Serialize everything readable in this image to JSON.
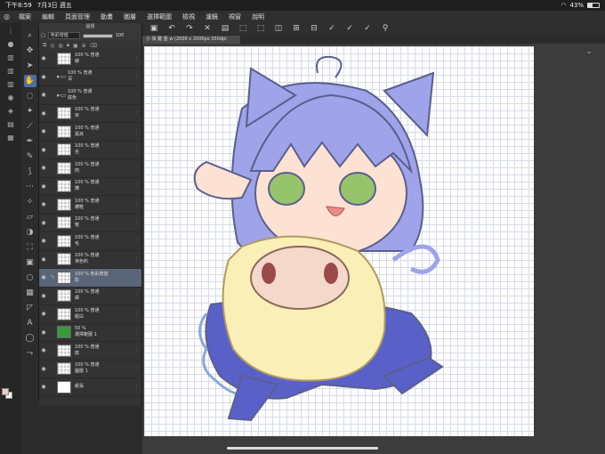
{
  "status": {
    "time": "下午8:59",
    "date": "7月3日 週五",
    "battery": "43%",
    "battery_level": 0.43
  },
  "menu": [
    "檔案",
    "編輯",
    "頁面管理",
    "動畫",
    "圖層",
    "選擇範圍",
    "檢視",
    "濾鏡",
    "視窗",
    "說明"
  ],
  "doc_tab": "小 保 鍵 盤 w (2000 x 2000px 350dpi 88.1%)",
  "layer_panel": {
    "title": "圖層",
    "blend_mode": "色彩增值",
    "opacity_value": "100",
    "opacity_level": 1.0,
    "layers": [
      {
        "pct": "100 %",
        "mode": "普通",
        "name": "線",
        "kind": "thumb"
      },
      {
        "pct": "100 %",
        "mode": "普通",
        "name": "深",
        "kind": "folder"
      },
      {
        "pct": "100 %",
        "mode": "普通",
        "name": "底色",
        "kind": "folder"
      },
      {
        "pct": "100 %",
        "mode": "普通",
        "name": "目",
        "kind": "thumb"
      },
      {
        "pct": "100 %",
        "mode": "普通",
        "name": "黑目",
        "kind": "thumb"
      },
      {
        "pct": "100 %",
        "mode": "普通",
        "name": "舌",
        "kind": "thumb"
      },
      {
        "pct": "100 %",
        "mode": "普通",
        "name": "肉",
        "kind": "thumb"
      },
      {
        "pct": "100 %",
        "mode": "普通",
        "name": "襪",
        "kind": "thumb"
      },
      {
        "pct": "100 %",
        "mode": "普通",
        "name": "襪鞋",
        "kind": "thumb"
      },
      {
        "pct": "100 %",
        "mode": "普通",
        "name": "鞋",
        "kind": "thumb"
      },
      {
        "pct": "100 %",
        "mode": "普通",
        "name": "毛",
        "kind": "thumb"
      },
      {
        "pct": "100 %",
        "mode": "普通",
        "name": "漸色料",
        "kind": "thumb"
      },
      {
        "pct": "100 %",
        "mode": "色彩增值",
        "name": "影",
        "kind": "thumb",
        "selected": true
      },
      {
        "pct": "100 %",
        "mode": "普通",
        "name": "膚",
        "kind": "thumb"
      },
      {
        "pct": "100 %",
        "mode": "普通",
        "name": "眼白",
        "kind": "thumb"
      },
      {
        "pct": "50 %",
        "mode": "",
        "name": "選擇範圍 1",
        "kind": "green"
      },
      {
        "pct": "100 %",
        "mode": "普通",
        "name": "底",
        "kind": "thumb"
      },
      {
        "pct": "100 %",
        "mode": "普通",
        "name": "圖層 1",
        "kind": "thumb"
      },
      {
        "pct": "",
        "mode": "",
        "name": "紙張",
        "kind": "white"
      }
    ]
  },
  "colors": {
    "fg": "#f0c9c0",
    "bg": "#ffffff",
    "hair": "#9fa3ea",
    "skin": "#fde1d3",
    "eye": "#96c46a",
    "sheep": "#fbefb8",
    "outline": "#5a5f8c",
    "dress": "#5960c8"
  }
}
